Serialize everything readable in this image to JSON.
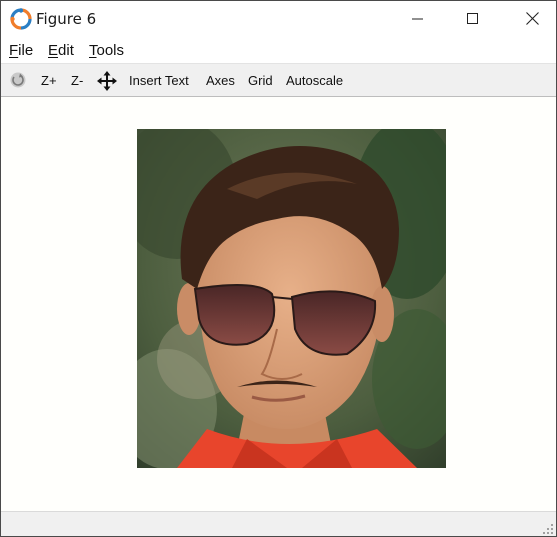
{
  "window": {
    "title": "Figure 6"
  },
  "menu": {
    "file": "ile",
    "file_mnemonic": "F",
    "edit": "dit",
    "edit_mnemonic": "E",
    "tools": "ools",
    "tools_mnemonic": "T"
  },
  "toolbar": {
    "zoom_in": "Z+",
    "zoom_out": "Z-",
    "insert_text": "Insert Text",
    "axes": "Axes",
    "grid": "Grid",
    "autoscale": "Autoscale",
    "icons": [
      "rotate-icon",
      "pan-icon"
    ]
  },
  "figure": {
    "image_description_icon": "photo-icon"
  },
  "colors": {
    "titlebar_bg": "#ffffff",
    "toolbar_bg": "#f0f0f0",
    "canvas_bg": "#fffffc",
    "shirt": "#e8452c",
    "hair": "#3b2418"
  }
}
